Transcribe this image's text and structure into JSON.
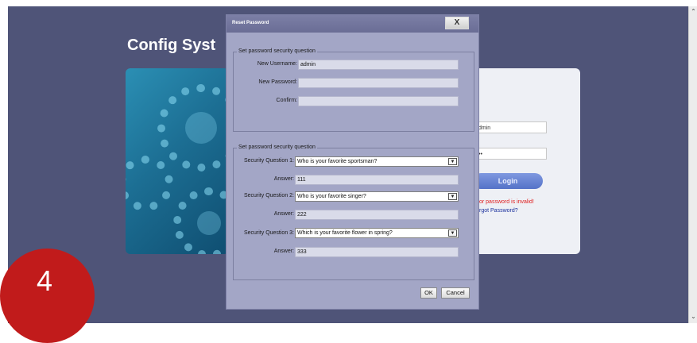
{
  "background": {
    "title": "Config Syst",
    "login": {
      "username_value": "dmin",
      "password_value": "••",
      "login_button": "Login",
      "error_text": "or password is invalid!",
      "forgot_link": "rgot Password?"
    }
  },
  "dialog": {
    "title": "Reset Password",
    "close_label": "X",
    "group1": {
      "legend": "Set password security question",
      "username_label": "New Username:",
      "username_value": "admin",
      "password_label": "New Password:",
      "password_value": "",
      "confirm_label": "Confirm:",
      "confirm_value": ""
    },
    "group2": {
      "legend": "Set password security question",
      "questions": [
        {
          "label": "Security Question 1:",
          "value": "Who is your favorite sportsman?",
          "answer_label": "Answer:",
          "answer": "111"
        },
        {
          "label": "Security Question 2:",
          "value": "Who is your favorite singer?",
          "answer_label": "Answer:",
          "answer": "222"
        },
        {
          "label": "Security Question 3:",
          "value": "Which is your favorite flower in spring?",
          "answer_label": "Answer:",
          "answer": "333"
        }
      ]
    },
    "ok_label": "OK",
    "cancel_label": "Cancel"
  },
  "step_badge": "4",
  "colors": {
    "backdrop": "#4f5478",
    "dialog": "#a3a6c6",
    "badge": "#c11b1b",
    "login_button": "#5572c8",
    "error_text": "#e02020"
  }
}
